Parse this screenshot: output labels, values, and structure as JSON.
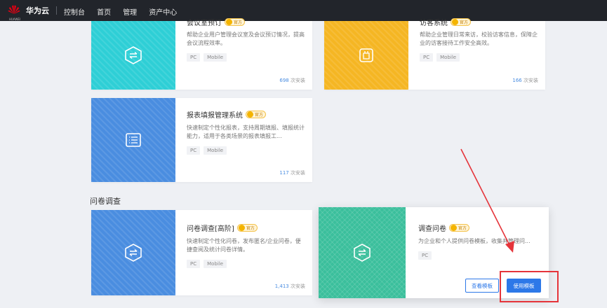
{
  "header": {
    "logo_text": "HUAWEI",
    "brand": "华为云",
    "nav": [
      "控制台",
      "首页",
      "管理",
      "资产中心"
    ]
  },
  "cards": {
    "meeting": {
      "title": "会议室预订",
      "badge": "官方",
      "desc": "帮助企业用户管理会议室及会议预订情况，提高会议流程效率。",
      "tags": [
        "PC",
        "Mobile"
      ],
      "installs_num": "698",
      "installs_unit": "次安装",
      "color": "#2ecfd6"
    },
    "visitor": {
      "title": "访客系统",
      "badge": "官方",
      "desc": "帮助企业管理日常来访，校验访客信息，保障企业的访客接待工作安全高效。",
      "tags": [
        "PC",
        "Mobile"
      ],
      "installs_num": "166",
      "installs_unit": "次安装",
      "color": "#f5b623"
    },
    "report": {
      "title": "报表填报管理系统",
      "badge": "官方",
      "desc": "快速制定个性化报表，支持周期填报、填报统计能力，适用于各类场景的报表填报工...",
      "tags": [
        "PC",
        "Mobile"
      ],
      "installs_num": "117",
      "installs_unit": "次安装",
      "color": "#4a8de0"
    },
    "survey_adv": {
      "title": "问卷调查[高阶]",
      "badge": "官方",
      "desc": "快速制定个性化问卷，发布匿名/企业问卷，便捷查阅及统计问卷详情。",
      "tags": [
        "PC",
        "Mobile"
      ],
      "installs_num": "1,413",
      "installs_unit": "次安装",
      "color": "#4a8de0"
    },
    "survey": {
      "title": "调查问卷",
      "badge": "官方",
      "desc": "为企业和个人提供问卷模板，收集并管理问...",
      "tags": [
        "PC"
      ],
      "color": "#3bbf9c",
      "view_label": "查看模板",
      "use_label": "使用模板"
    }
  },
  "section": {
    "survey_title": "问卷调查"
  },
  "colors": {
    "accent": "#2d78e8",
    "highlight": "#e5343a"
  }
}
